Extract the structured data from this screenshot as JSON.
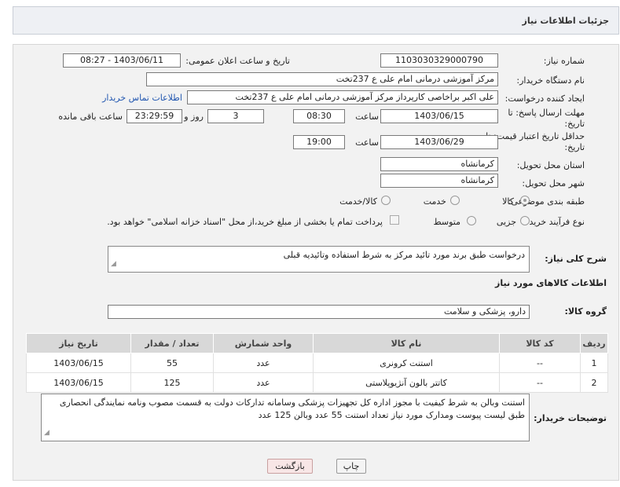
{
  "header": {
    "title": "جزئیات اطلاعات نیاز"
  },
  "form": {
    "need_number_label": "شماره نیاز:",
    "need_number": "1103030329000790",
    "announce_label": "تاریخ و ساعت اعلان عمومی:",
    "announce_value": "1403/06/11 - 08:27",
    "buyer_org_label": "نام دستگاه خریدار:",
    "buyer_org": "مرکز آموزشی درمانی امام علی ع 237تخت",
    "creator_label": "ایجاد کننده درخواست:",
    "creator": "علی اکبر براخاصی کارپرداز  مرکز آموزشی درمانی امام علی ع 237تخت",
    "contact_link": "اطلاعات تماس خریدار",
    "reply_deadline_label": "مهلت ارسال پاسخ: تا",
    "reply_deadline_label2": "تاریخ:",
    "reply_date": "1403/06/15",
    "time_label": "ساعت",
    "reply_time": "08:30",
    "days_value": "3",
    "days_label": "روز و",
    "remaining_time": "23:29:59",
    "remaining_label": "ساعت باقی مانده",
    "validity_label": "حداقل تاریخ اعتبار قیمت: تا",
    "validity_label2": "تاریخ:",
    "validity_date": "1403/06/29",
    "validity_time": "19:00",
    "province_label": "استان محل تحویل:",
    "province": "کرمانشاه",
    "city_label": "شهر محل تحویل:",
    "city": "کرمانشاه",
    "category_label": "طبقه بندی موضوعی:",
    "category_options": [
      "کالا",
      "خدمت",
      "کالا/خدمت"
    ],
    "process_label": "نوع فرآیند خرید :",
    "process_options": [
      "جزیی",
      "متوسط"
    ],
    "payment_note": "پرداخت تمام یا بخشی از مبلغ خرید،از محل \"اسناد خزانه اسلامی\" خواهد بود."
  },
  "description": {
    "label": "شرح کلی نیاز:",
    "text": "درخواست طبق برند مورد تائید مرکز به شرط استفاده وتائیدیه قبلی"
  },
  "goods": {
    "section_title": "اطلاعات کالاهای مورد نیاز",
    "group_label": "گروه کالا:",
    "group_value": "دارو، پزشکی و سلامت",
    "columns": [
      "ردیف",
      "کد کالا",
      "نام کالا",
      "واحد شمارش",
      "تعداد / مقدار",
      "تاریخ نیاز"
    ],
    "rows": [
      {
        "idx": "1",
        "code": "--",
        "name": "استنت کرونری",
        "unit": "عدد",
        "qty": "55",
        "date": "1403/06/15"
      },
      {
        "idx": "2",
        "code": "--",
        "name": "کاتتر بالون آنژیوپلاستی",
        "unit": "عدد",
        "qty": "125",
        "date": "1403/06/15"
      }
    ]
  },
  "buyer_notes": {
    "label": "توضیحات خریدار:",
    "text": "استنت وبالن به شرط کیفیت با مجوز اداره کل تجهیزات پزشکی وسامانه تدارکات دولت به قسمت مصوب ونامه نمایندگی انحصاری طبق لیست پیوست ومدارک مورد نیاز تعداد استنت 55 عدد وبالن 125 عدد"
  },
  "buttons": {
    "print": "چاپ",
    "back": "بازگشت"
  }
}
